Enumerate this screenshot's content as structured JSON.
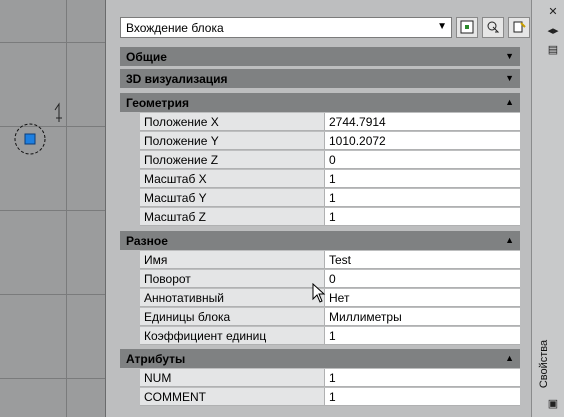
{
  "selector": {
    "value": "Вхождение блока"
  },
  "toolbar": {
    "icons": [
      "quick-select-icon",
      "select-objects-icon",
      "toggle-pickadd-icon"
    ]
  },
  "side": {
    "title": "Свойства",
    "icons": [
      "close-icon",
      "autohide-icon",
      "properties-menu-icon"
    ]
  },
  "sections": {
    "general": {
      "title": "Общие",
      "collapsed": true
    },
    "viz3d": {
      "title": "3D визуализация",
      "collapsed": true
    },
    "geometry": {
      "title": "Геометрия",
      "rows": [
        {
          "label": "Положение X",
          "value": "2744.7914"
        },
        {
          "label": "Положение Y",
          "value": "1010.2072"
        },
        {
          "label": "Положение Z",
          "value": "0"
        },
        {
          "label": "Масштаб X",
          "value": "1"
        },
        {
          "label": "Масштаб Y",
          "value": "1"
        },
        {
          "label": "Масштаб Z",
          "value": "1"
        }
      ]
    },
    "misc": {
      "title": "Разное",
      "rows": [
        {
          "label": "Имя",
          "value": "Test"
        },
        {
          "label": "Поворот",
          "value": "0"
        },
        {
          "label": "Аннотативный",
          "value": "Нет"
        },
        {
          "label": "Единицы блока",
          "value": "Миллиметры"
        },
        {
          "label": "Коэффициент единиц",
          "value": "1"
        }
      ]
    },
    "attributes": {
      "title": "Атрибуты",
      "rows": [
        {
          "label": "NUM",
          "value": "1"
        },
        {
          "label": "COMMENT",
          "value": "1"
        }
      ]
    }
  }
}
